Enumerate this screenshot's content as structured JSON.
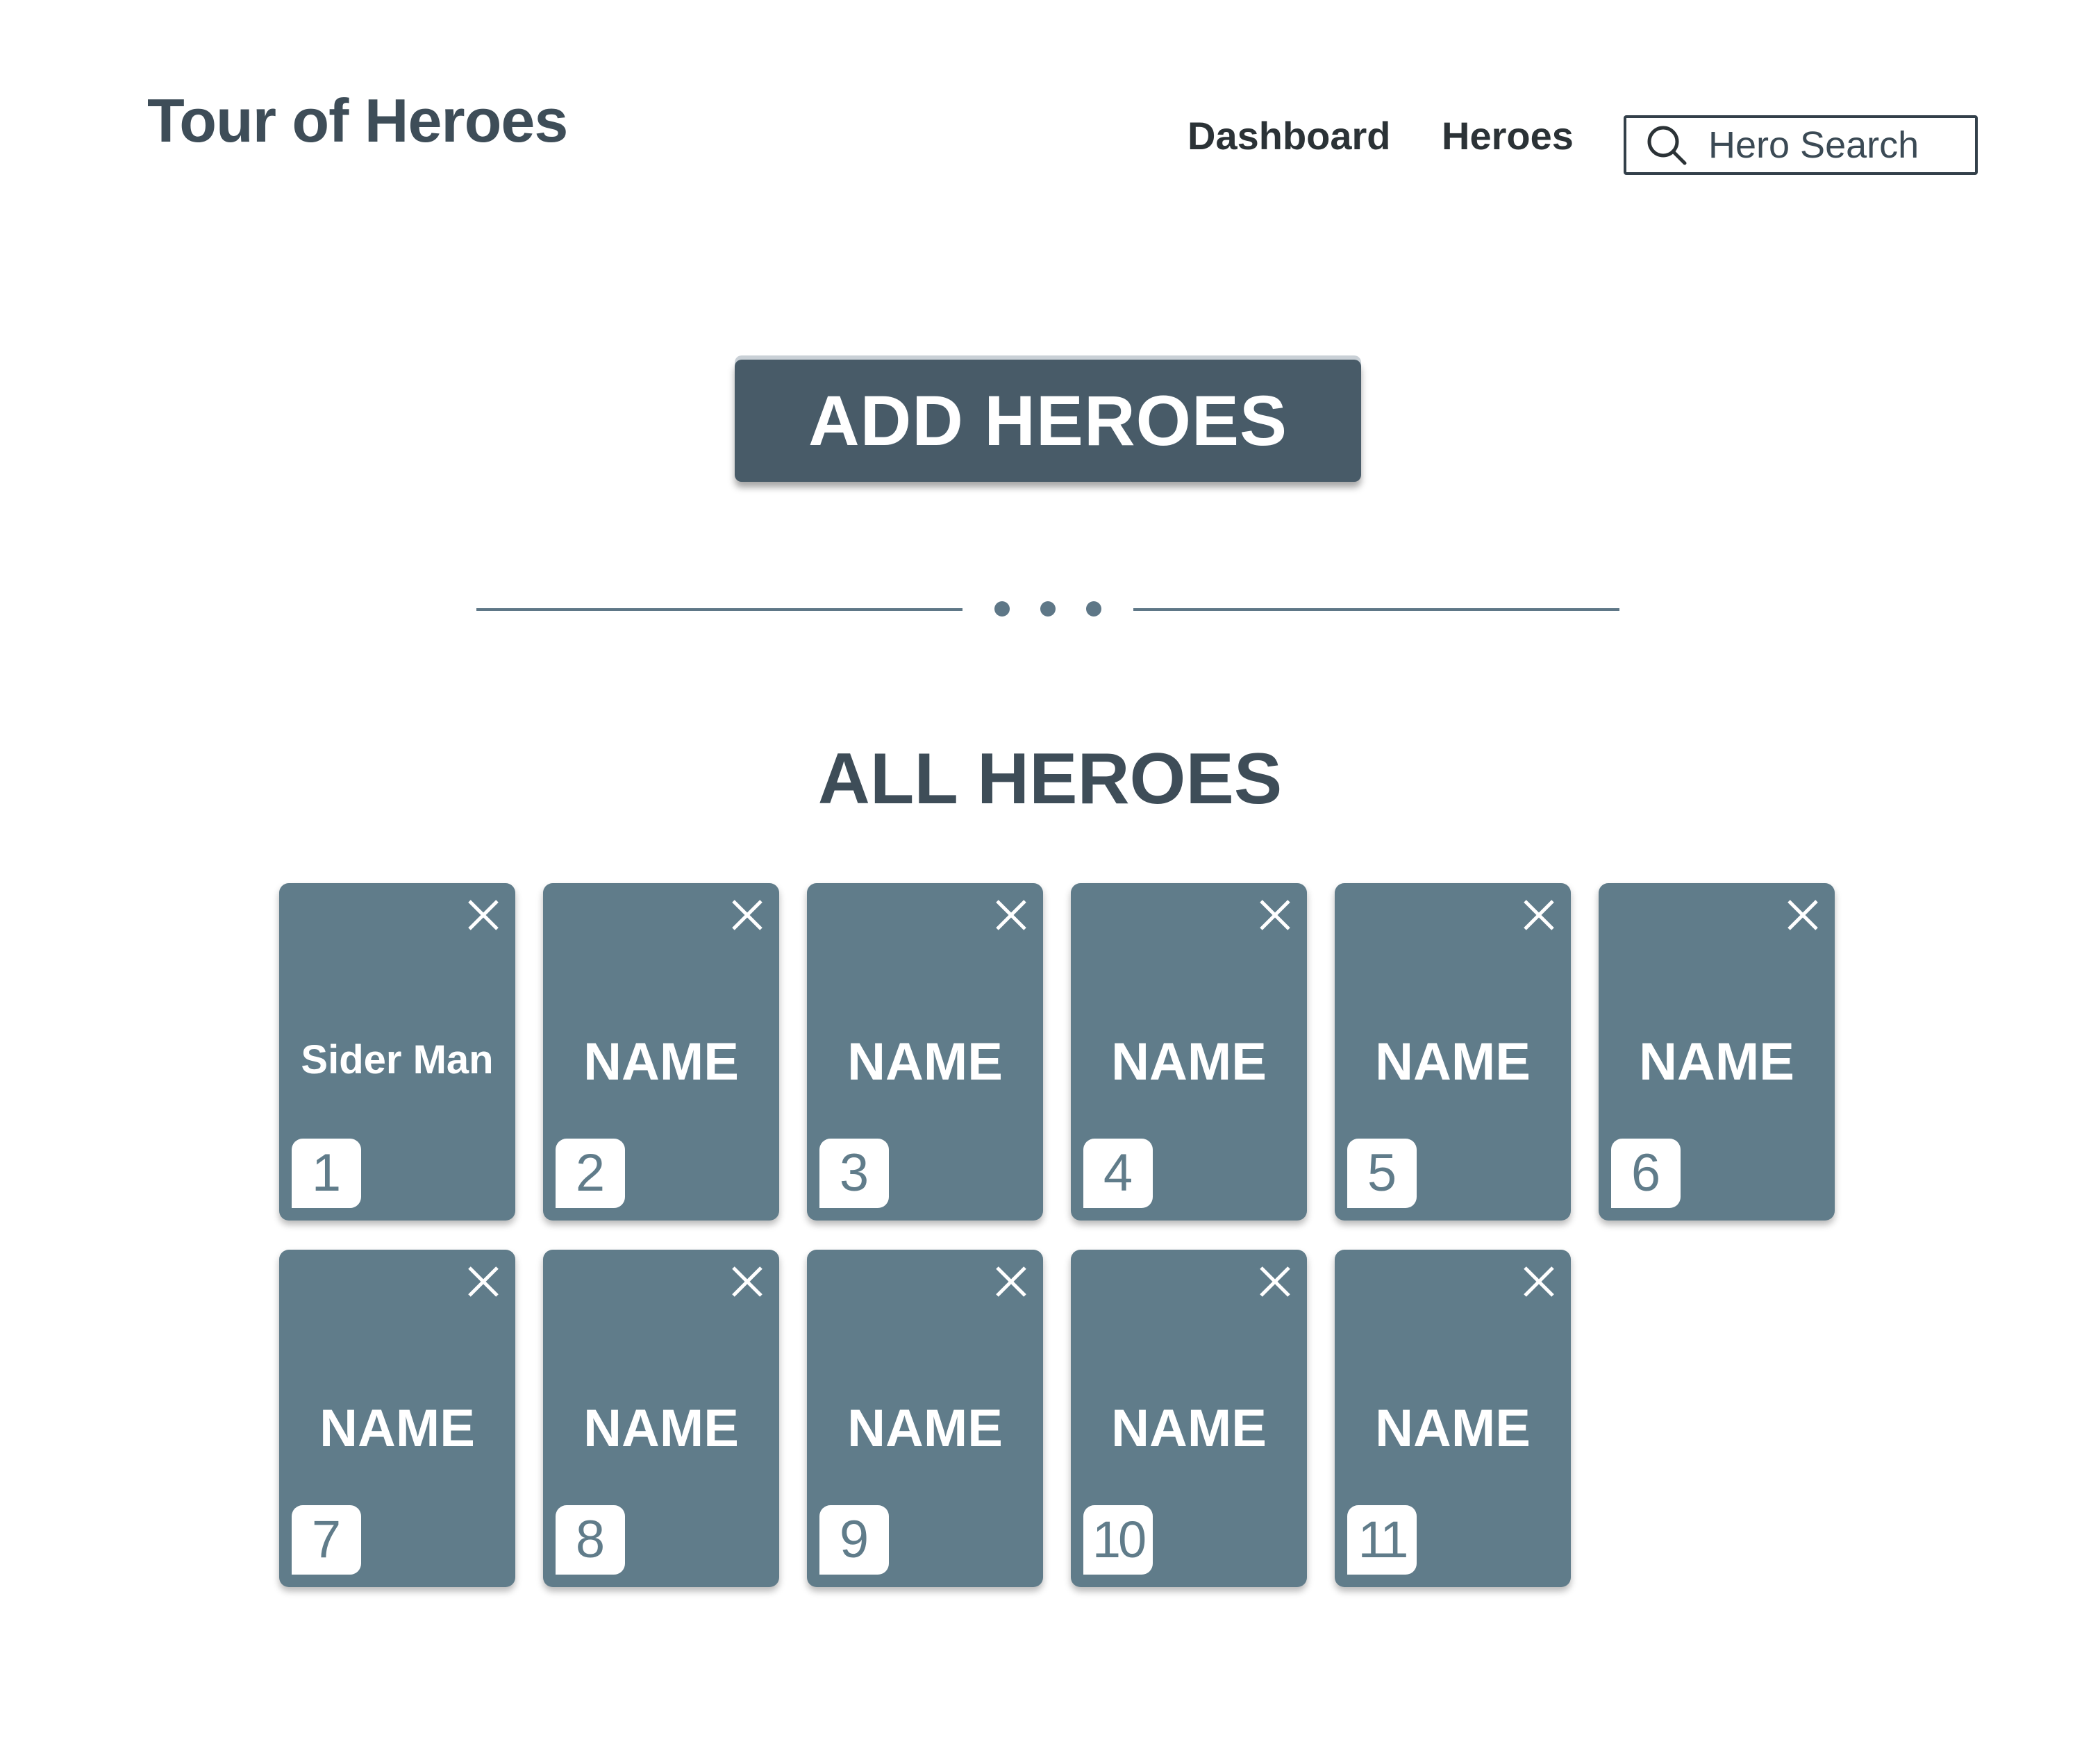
{
  "header": {
    "title": "Tour of Heroes",
    "nav": [
      {
        "label": "Dashboard"
      },
      {
        "label": "Heroes"
      }
    ],
    "search": {
      "placeholder": "Hero Search",
      "icon": "search-icon"
    }
  },
  "actions": {
    "add_label": "ADD HEROES"
  },
  "section": {
    "title": "ALL HEROES"
  },
  "heroes": [
    {
      "id": "1",
      "name": "Sider Man"
    },
    {
      "id": "2",
      "name": "NAME"
    },
    {
      "id": "3",
      "name": "NAME"
    },
    {
      "id": "4",
      "name": "NAME"
    },
    {
      "id": "5",
      "name": "NAME"
    },
    {
      "id": "6",
      "name": "NAME"
    },
    {
      "id": "7",
      "name": "NAME"
    },
    {
      "id": "8",
      "name": "NAME"
    },
    {
      "id": "9",
      "name": "NAME"
    },
    {
      "id": "10",
      "name": "NAME"
    },
    {
      "id": "11",
      "name": "NAME"
    }
  ],
  "colors": {
    "card": "#607c8a",
    "button": "#485b68",
    "heading": "#3e4d58"
  }
}
